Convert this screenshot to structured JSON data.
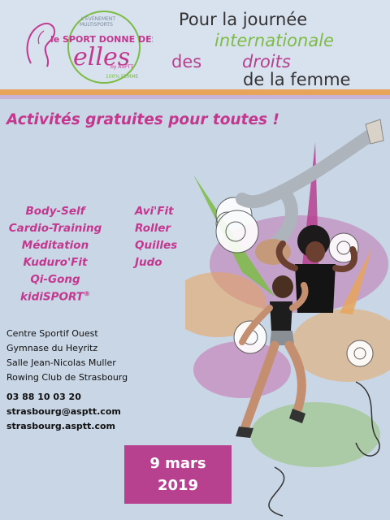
{
  "logo": {
    "line1": "L'ÉVÉNEMENT",
    "line2": "MULTISPORTS",
    "text_main": "le SPORT DONNE DES",
    "text_script": "elles",
    "text_by": "by ASPTT",
    "text_sub": "100% FEMME"
  },
  "header": {
    "line1": "Pour la journée",
    "line2": "internationale",
    "line3a": "des",
    "line3b": "droits",
    "line4": "de la femme"
  },
  "headline": "Activités gratuites pour toutes !",
  "activities_left": [
    "Body-Self",
    "Cardio-Training",
    "Méditation",
    "Kuduro'Fit",
    "Qi-Gong",
    "kidiSPORT"
  ],
  "activities_left_mark": "®",
  "activities_right": [
    "Avi'Fit",
    "Roller",
    "Quilles",
    "Judo"
  ],
  "venues": [
    "Centre Sportif Ouest",
    "Gymnase du Heyritz",
    "Salle Jean-Nicolas Muller",
    "Rowing Club de Strasbourg"
  ],
  "contacts": [
    "03 88 10 03 20",
    "strasbourg@asptt.com",
    "strasbourg.asptt.com"
  ],
  "date": {
    "day": "9 mars",
    "year": "2019"
  },
  "colors": {
    "background": "#c9d6e6",
    "accent_magenta": "#c4378e",
    "accent_green": "#7cbc45",
    "stripe_orange": "#e7a45a",
    "date_box": "#b7408f"
  }
}
